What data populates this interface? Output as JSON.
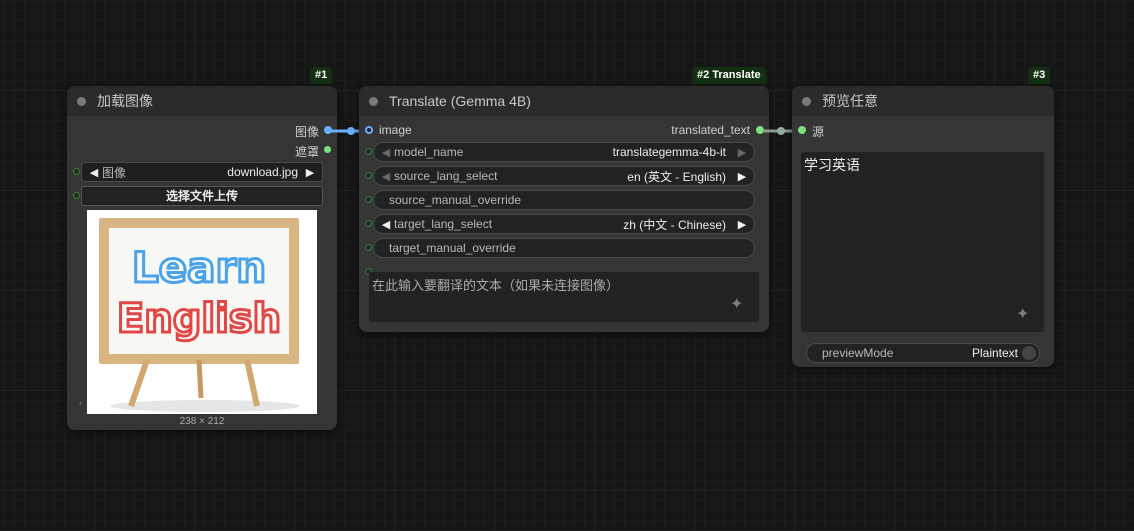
{
  "nodes": {
    "load_image": {
      "badge": "#1",
      "title": "加载图像",
      "outputs": {
        "image": "图像",
        "mask": "遮罩"
      },
      "image_widget": {
        "label": "图像",
        "value": "download.jpg"
      },
      "upload_button": "选择文件上传",
      "preview": {
        "line1": "Learn",
        "line2": "English"
      },
      "dimensions": "238 × 212"
    },
    "translate": {
      "badge": "#2 Translate",
      "title": "Translate (Gemma 4B)",
      "input_image": "image",
      "output_text": "translated_text",
      "model_name": {
        "label": "model_name",
        "value": "translategemma-4b-it"
      },
      "source_lang_select": {
        "label": "source_lang_select",
        "value": "en (英文 - English)"
      },
      "source_manual_override": {
        "placeholder": "source_manual_override"
      },
      "target_lang_select": {
        "label": "target_lang_select",
        "value": "zh (中文 - Chinese)"
      },
      "target_manual_override": {
        "placeholder": "target_manual_override"
      },
      "text_input": {
        "placeholder": "在此输入要翻译的文本（如果未连接图像）"
      }
    },
    "preview_text": {
      "badge": "#3",
      "title": "预览任意",
      "input_source": "源",
      "content": "学习英语",
      "preview_mode": {
        "label": "previewMode",
        "value": "Plaintext"
      }
    }
  },
  "colors": {
    "image_link": "#6ab0ff",
    "string_link": "#7ee07e",
    "badge_bg": "#133013"
  }
}
